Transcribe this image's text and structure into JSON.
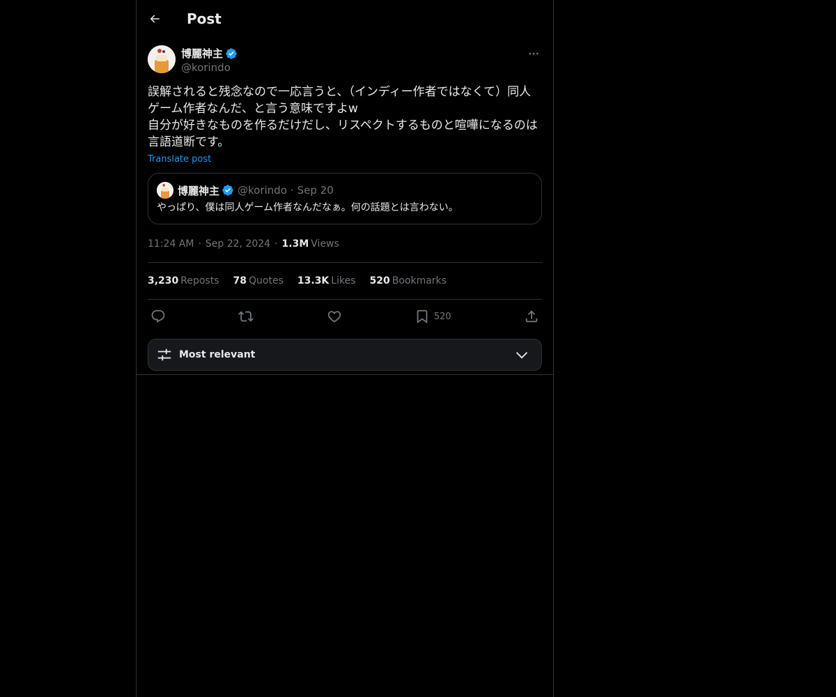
{
  "header": {
    "title": "Post"
  },
  "post": {
    "author": {
      "name": "博麗神主",
      "handle": "@korindo"
    },
    "text_lines": [
      "誤解されると残念なので一応言うと、（インディー作者ではなくて）同人",
      "ゲーム作者なんだ、と言う意味ですよw",
      "自分が好きなものを作るだけだし、リスペクトするものと喧嘩になるのは",
      "言語道断です。"
    ],
    "translate_label": "Translate post",
    "quote": {
      "name": "博麗神主",
      "handle": "@korindo",
      "dot": "·",
      "date": "Sep 20",
      "text": "やっぱり、僕は同人ゲーム作者なんだなぁ。何の話題とは言わない。"
    },
    "meta": {
      "time": "11:24 AM",
      "sep": "·",
      "date": "Sep 22, 2024",
      "views_count": "1.3M",
      "views_label": "Views"
    },
    "stats": {
      "reposts_count": "3,230",
      "reposts_label": "Reposts",
      "quotes_count": "78",
      "quotes_label": "Quotes",
      "likes_count": "13.3K",
      "likes_label": "Likes",
      "bookmarks_count": "520",
      "bookmarks_label": "Bookmarks"
    },
    "actions": {
      "bookmark_count": "520"
    }
  },
  "replies_sort": {
    "label": "Most relevant"
  },
  "colors": {
    "accent": "#1d9bf0",
    "background": "#000000",
    "border": "#2f3336",
    "muted": "#71767b"
  },
  "icons": [
    "back-arrow-icon",
    "verified-badge-icon",
    "more-icon",
    "reply-icon",
    "repost-icon",
    "like-icon",
    "bookmark-icon",
    "share-icon",
    "sort-filter-icon",
    "chevron-down-icon"
  ]
}
